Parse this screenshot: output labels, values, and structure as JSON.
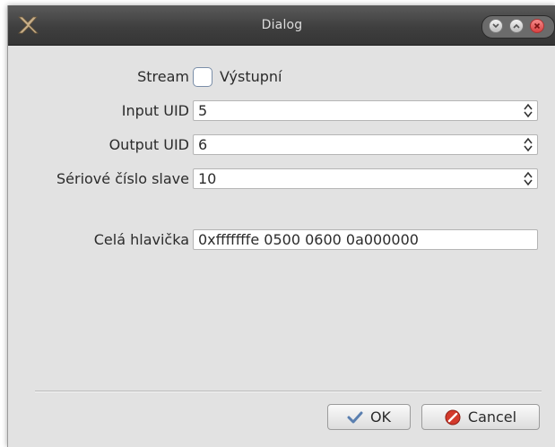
{
  "window": {
    "title": "Dialog",
    "controls": {
      "minimize_icon": "chevron-down-icon",
      "maximize_icon": "chevron-up-icon",
      "close_icon": "close-icon"
    }
  },
  "form": {
    "stream": {
      "label": "Stream",
      "checkbox_label": "Výstupní",
      "checked": false
    },
    "input_uid": {
      "label": "Input UID",
      "value": "5"
    },
    "output_uid": {
      "label": "Output UID",
      "value": "6"
    },
    "slave_serial": {
      "label": "Sériové číslo slave",
      "value": "10"
    },
    "header": {
      "label": "Celá hlavička",
      "value": "0xfffffffe 0500 0600 0a000000"
    }
  },
  "buttons": {
    "ok": {
      "label": "OK",
      "icon": "checkmark-icon"
    },
    "cancel": {
      "label": "Cancel",
      "icon": "cancel-icon"
    }
  },
  "colors": {
    "titlebar": "#3f3f3f",
    "dialog_bg": "#e2e2e2",
    "close_button": "#d94141"
  }
}
